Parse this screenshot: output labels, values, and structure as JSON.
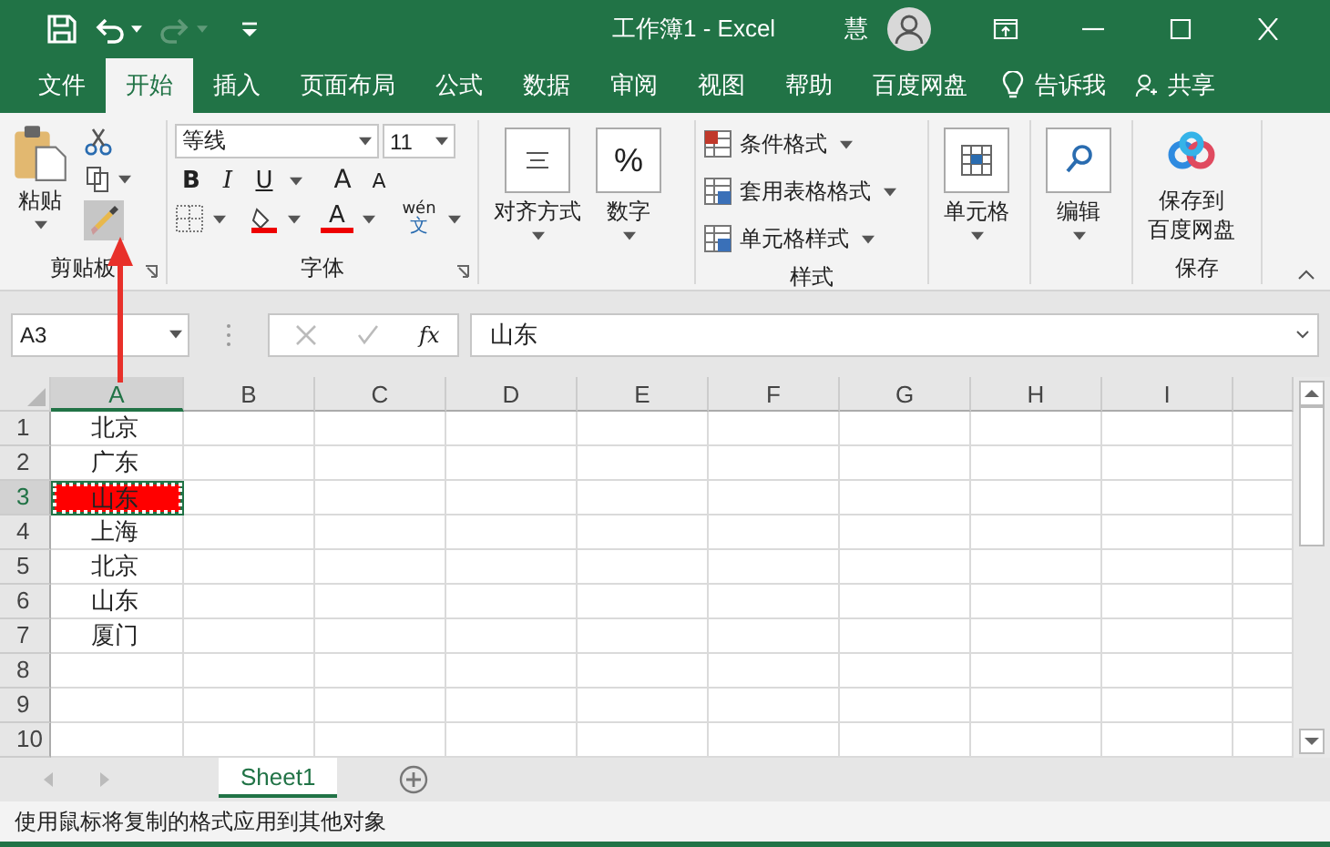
{
  "window": {
    "title": "工作簿1  -  Excel",
    "user": "慧"
  },
  "tabs": [
    {
      "label": "文件",
      "kind": "tab",
      "selected": false
    },
    {
      "label": "开始",
      "kind": "tab",
      "selected": true
    },
    {
      "label": "插入",
      "kind": "tab",
      "selected": false
    },
    {
      "label": "页面布局",
      "kind": "tab",
      "selected": false
    },
    {
      "label": "公式",
      "kind": "tab",
      "selected": false
    },
    {
      "label": "数据",
      "kind": "tab",
      "selected": false
    },
    {
      "label": "审阅",
      "kind": "tab",
      "selected": false
    },
    {
      "label": "视图",
      "kind": "tab",
      "selected": false
    },
    {
      "label": "帮助",
      "kind": "tab",
      "selected": false
    },
    {
      "label": "百度网盘",
      "kind": "tab",
      "selected": false
    },
    {
      "label": "告诉我",
      "kind": "tell-me",
      "selected": false
    },
    {
      "label": "共享",
      "kind": "share",
      "selected": false
    }
  ],
  "ribbon": {
    "clipboard": {
      "paste": "粘贴",
      "format_painter_on": true,
      "label": "剪贴板"
    },
    "font": {
      "name": "等线",
      "size": "11",
      "bold": "B",
      "italic": "I",
      "underline": "U",
      "grow": "A",
      "shrink": "A",
      "font_color": "A",
      "phonetic_top": "wén",
      "phonetic_bottom": "文",
      "label": "字体"
    },
    "alignment": {
      "label": "对齐方式"
    },
    "number": {
      "symbol": "%",
      "label": "数字"
    },
    "styles": {
      "items": [
        "条件格式",
        "套用表格格式",
        "单元格样式"
      ],
      "label": "样式"
    },
    "cells": {
      "label": "单元格"
    },
    "editing": {
      "label": "编辑"
    },
    "save": {
      "lines": [
        "保存到",
        "百度网盘"
      ],
      "label": "保存"
    }
  },
  "formula_bar": {
    "name_box": "A3",
    "fx": "fx",
    "value": "山东"
  },
  "columns": [
    {
      "label": "A",
      "selected": true
    },
    {
      "label": "B",
      "selected": false
    },
    {
      "label": "C",
      "selected": false
    },
    {
      "label": "D",
      "selected": false
    },
    {
      "label": "E",
      "selected": false
    },
    {
      "label": "F",
      "selected": false
    },
    {
      "label": "G",
      "selected": false
    },
    {
      "label": "H",
      "selected": false
    },
    {
      "label": "I",
      "selected": false
    }
  ],
  "rows": [
    {
      "number": "1",
      "selected": false,
      "cell_a": {
        "text": "北京",
        "selected": false
      }
    },
    {
      "number": "2",
      "selected": false,
      "cell_a": {
        "text": "广东",
        "selected": false
      }
    },
    {
      "number": "3",
      "selected": true,
      "cell_a": {
        "text": "山东",
        "selected": true,
        "color": "#ff0000"
      }
    },
    {
      "number": "4",
      "selected": false,
      "cell_a": {
        "text": "上海",
        "selected": false
      }
    },
    {
      "number": "5",
      "selected": false,
      "cell_a": {
        "text": "北京",
        "selected": false
      }
    },
    {
      "number": "6",
      "selected": false,
      "cell_a": {
        "text": "山东",
        "selected": false
      }
    },
    {
      "number": "7",
      "selected": false,
      "cell_a": {
        "text": "厦门",
        "selected": false
      }
    },
    {
      "number": "8",
      "selected": false
    },
    {
      "number": "9",
      "selected": false
    },
    {
      "number": "10",
      "selected": false
    }
  ],
  "sheets": [
    {
      "label": "Sheet1",
      "selected": true
    }
  ],
  "status_bar": {
    "message": "使用鼠标将复制的格式应用到其他对象"
  }
}
